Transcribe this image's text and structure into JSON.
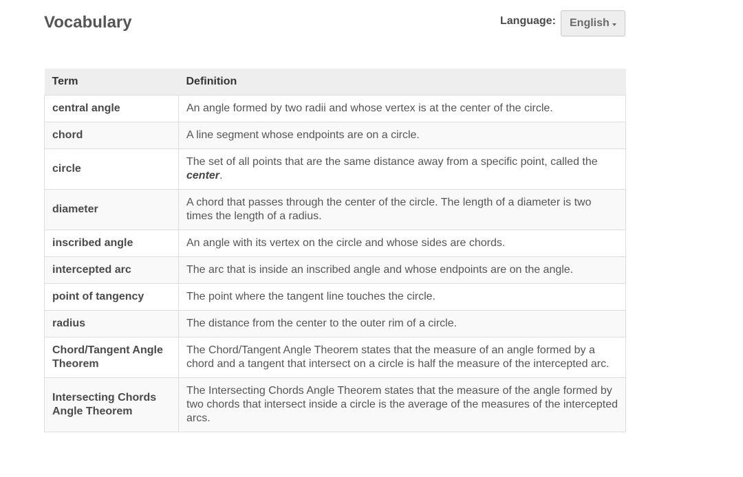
{
  "header": {
    "title": "Vocabulary",
    "language_label": "Language:",
    "language_value": "English"
  },
  "table": {
    "columns": [
      "Term",
      "Definition"
    ],
    "rows": [
      {
        "term": "central angle",
        "definition": "An angle formed by two radii and whose vertex is at the center of the circle."
      },
      {
        "term": "chord",
        "definition": "A line segment whose endpoints are on a circle."
      },
      {
        "term": "circle",
        "definition": "The set of all points that are the same distance away from a specific point, called the ",
        "emphasis": "center",
        "definition_end": "."
      },
      {
        "term": "diameter",
        "definition": "A chord that passes through the center of the circle. The length of a diameter is two times the length of a radius."
      },
      {
        "term": "inscribed angle",
        "definition": "An angle with its vertex on the circle and whose sides are chords."
      },
      {
        "term": "intercepted arc",
        "definition": "The arc that is inside an inscribed angle and whose endpoints are on the angle."
      },
      {
        "term": "point of tangency",
        "definition": "The point where the tangent line touches the circle."
      },
      {
        "term": "radius",
        "definition": "The distance from the center to the outer rim of a circle."
      },
      {
        "term": "Chord/Tangent Angle Theorem",
        "definition": "The Chord/Tangent Angle Theorem states that the measure of an angle formed by a chord and a tangent that intersect on a circle is half the measure of the intercepted arc."
      },
      {
        "term": "Intersecting Chords Angle Theorem",
        "definition": "The Intersecting Chords Angle Theorem states that the measure of the angle formed by two chords that intersect inside a circle is the average of the measures of the intercepted arcs."
      }
    ]
  }
}
